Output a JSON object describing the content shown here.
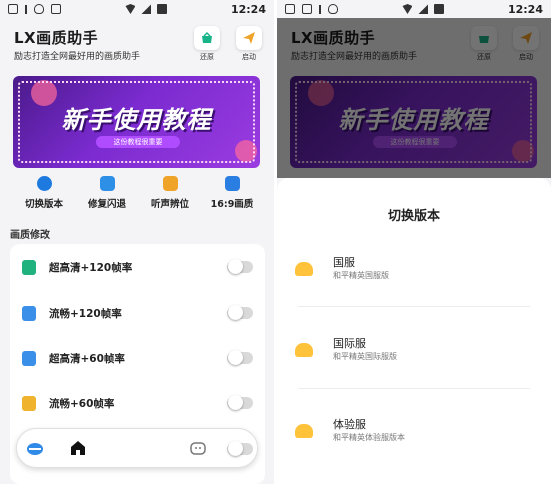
{
  "status": {
    "time": "12:24"
  },
  "app": {
    "title": "LX画质助手",
    "subtitle": "励志打造全网最好用的画质助手",
    "restore_label": "还原",
    "launch_label": "启动"
  },
  "banner": {
    "title": "新手使用教程",
    "subtitle": "这份教程很重要"
  },
  "quick_actions": [
    {
      "label": "切换版本",
      "icon": "version-icon",
      "color": "#1f7ae0"
    },
    {
      "label": "修复闪退",
      "icon": "repair-icon",
      "color": "#2e8fe6"
    },
    {
      "label": "听声辨位",
      "icon": "sound-icon",
      "color": "#f0a329"
    },
    {
      "label": "16:9画质",
      "icon": "ratio-icon",
      "color": "#2a7de1"
    }
  ],
  "section": {
    "label": "画质修改"
  },
  "settings": [
    {
      "label": "超高清+120帧率",
      "color": "#1fb27f"
    },
    {
      "label": "流畅+120帧率",
      "color": "#3a8fe8"
    },
    {
      "label": "超高清+60帧率",
      "color": "#3a8fe8"
    },
    {
      "label": "流畅+60帧率",
      "color": "#f0b32e"
    }
  ],
  "version_sheet": {
    "title": "切换版本",
    "options": [
      {
        "name": "国服",
        "desc": "和平精英国服版"
      },
      {
        "name": "国际服",
        "desc": "和平精英国际服版"
      },
      {
        "name": "体验服",
        "desc": "和平精英体验服版本"
      }
    ]
  }
}
